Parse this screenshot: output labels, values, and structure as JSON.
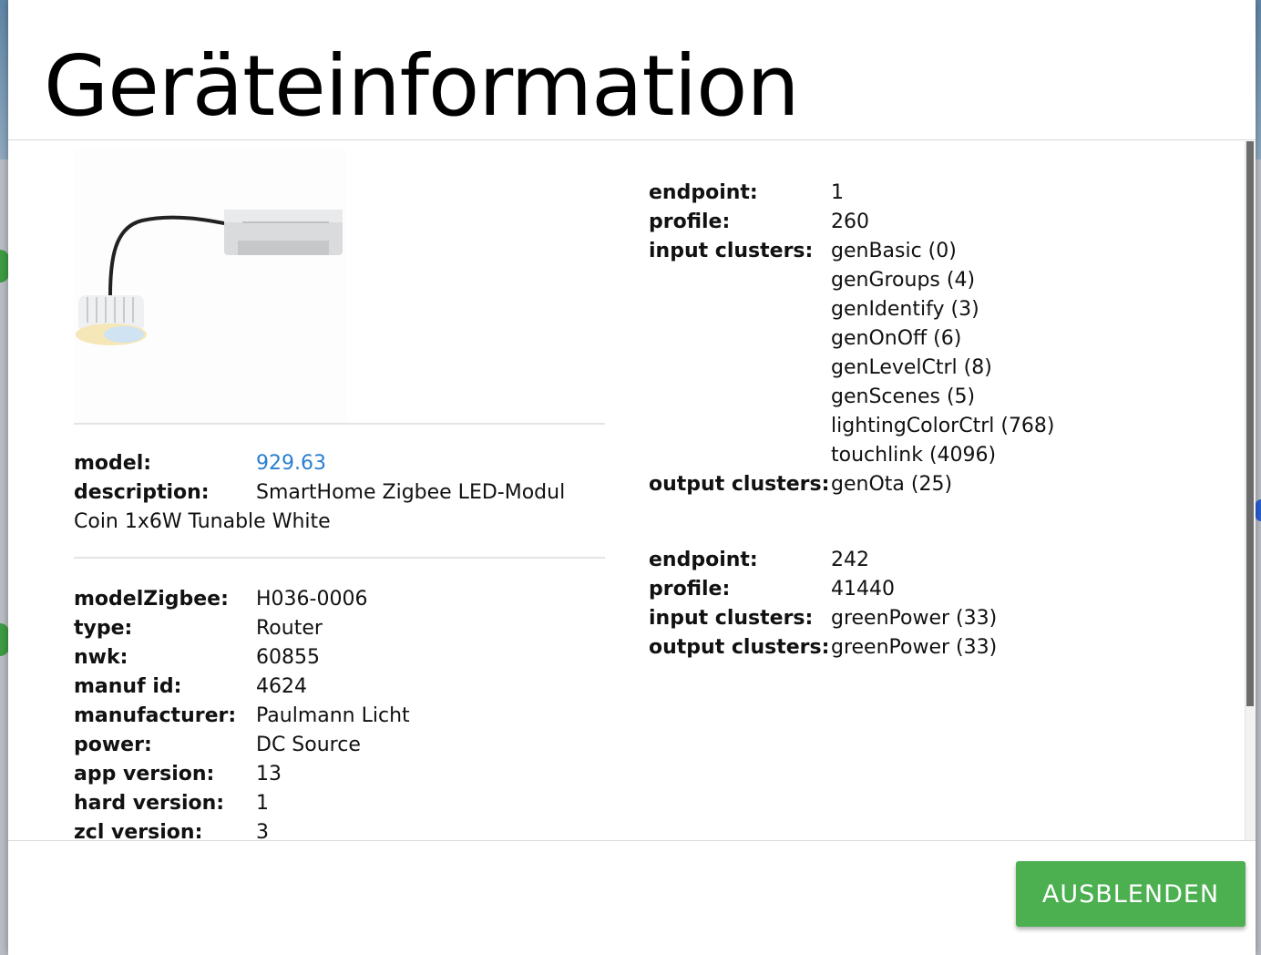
{
  "modal": {
    "title": "Geräteinformation",
    "hide_button": "AUSBLENDEN"
  },
  "device": {
    "model_label": "model:",
    "model_value": "929.63",
    "description_label": "description:",
    "description_line1": "SmartHome Zigbee LED-Modul",
    "description_line2": "Coin 1x6W Tunable White",
    "details": [
      {
        "label": "modelZigbee:",
        "value": "H036-0006"
      },
      {
        "label": "type:",
        "value": "Router"
      },
      {
        "label": "nwk:",
        "value": "60855"
      },
      {
        "label": "manuf id:",
        "value": "4624"
      },
      {
        "label": "manufacturer:",
        "value": "Paulmann Licht"
      },
      {
        "label": "power:",
        "value": "DC Source"
      },
      {
        "label": "app version:",
        "value": "13"
      },
      {
        "label": "hard version:",
        "value": "1"
      },
      {
        "label": "zcl version:",
        "value": "3"
      }
    ]
  },
  "endpoints": [
    {
      "endpoint_label": "endpoint:",
      "endpoint": "1",
      "profile_label": "profile:",
      "profile": "260",
      "input_label": "input clusters:",
      "input_clusters": [
        "genBasic (0)",
        "genGroups (4)",
        "genIdentify (3)",
        "genOnOff (6)",
        "genLevelCtrl (8)",
        "genScenes (5)",
        "lightingColorCtrl (768)",
        "touchlink (4096)"
      ],
      "output_label": "output clusters:",
      "output_clusters": [
        "genOta (25)"
      ]
    },
    {
      "endpoint_label": "endpoint:",
      "endpoint": "242",
      "profile_label": "profile:",
      "profile": "41440",
      "input_label": "input clusters:",
      "input_clusters": [
        "greenPower (33)"
      ],
      "output_label": "output clusters:",
      "output_clusters": [
        "greenPower (33)"
      ]
    }
  ],
  "colors": {
    "accent_button": "#4caf50",
    "link": "#2a7fd0"
  }
}
